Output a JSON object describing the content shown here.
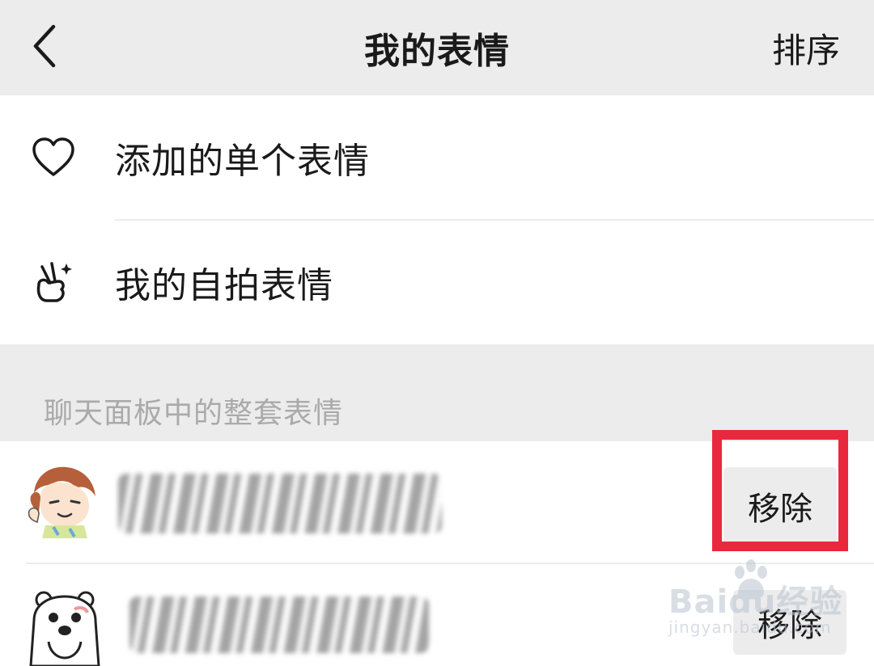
{
  "header": {
    "title": "我的表情",
    "sort_label": "排序",
    "back_icon": "chevron-left-icon"
  },
  "menu": {
    "items": [
      {
        "label": "添加的单个表情",
        "icon": "heart-outline-icon"
      },
      {
        "label": "我的自拍表情",
        "icon": "victory-hand-sparkle-icon"
      }
    ]
  },
  "section": {
    "title": "聊天面板中的整套表情"
  },
  "packs": [
    {
      "name": "",
      "action_label": "移除",
      "thumb": "anime-character-sticker"
    },
    {
      "name": "",
      "action_label": "移除",
      "thumb": "cartoon-bear-sticker"
    }
  ],
  "colors": {
    "topbar_bg": "#ececec",
    "section_text": "#aaaaaa",
    "highlight": "#e8293d",
    "button_bg": "#ececec"
  },
  "watermark": {
    "brand": "Baidu经验",
    "sub": "jingyan.baidu.com"
  }
}
